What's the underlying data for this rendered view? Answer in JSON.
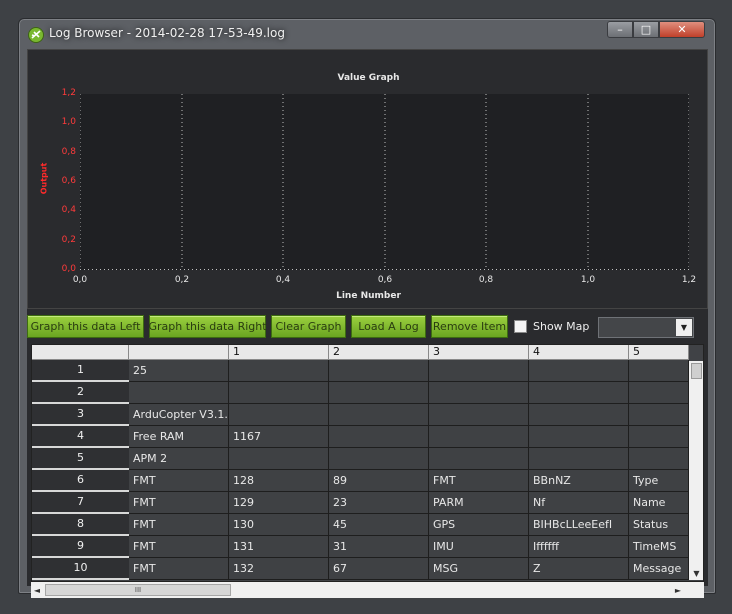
{
  "window": {
    "title": "Log Browser - 2014-02-28 17-53-49.log",
    "minimize_glyph": "–",
    "maximize_glyph": "□",
    "close_glyph": "✕"
  },
  "chart_data": {
    "type": "line",
    "title": "Value Graph",
    "xlabel": "Line Number",
    "ylabel": "Output",
    "x_ticks": [
      "0,0",
      "0,2",
      "0,4",
      "0,6",
      "0,8",
      "1,0",
      "1,2"
    ],
    "y_ticks": [
      "1,2",
      "1,0",
      "0,8",
      "0,6",
      "0,4",
      "0,2",
      "0,0"
    ],
    "xlim": [
      0,
      1.2
    ],
    "ylim": [
      0,
      1.2
    ],
    "series": [],
    "grid": true,
    "colors": {
      "background": "#1f2023",
      "ytick": "#ff3b3b",
      "ylabel": "#ff2a2a",
      "xtick": "#e8e8e8"
    }
  },
  "toolbar": {
    "graph_left": "Graph this data Left",
    "graph_right": "Graph this data Right",
    "clear_graph": "Clear Graph",
    "load_log": "Load A Log",
    "remove_item": "Remove Item",
    "show_map": "Show Map",
    "show_map_checked": false,
    "combo_value": ""
  },
  "grid": {
    "columns": [
      "",
      "1",
      "2",
      "3",
      "4",
      "5"
    ],
    "rows": [
      {
        "num": "1",
        "cells": [
          "25",
          "",
          "",
          "",
          "",
          ""
        ]
      },
      {
        "num": "2",
        "cells": [
          "",
          "",
          "",
          "",
          "",
          ""
        ]
      },
      {
        "num": "3",
        "cells": [
          "ArduCopter V3.1....",
          "",
          "",
          "",
          "",
          ""
        ]
      },
      {
        "num": "4",
        "cells": [
          "Free RAM",
          "1167",
          "",
          "",
          "",
          ""
        ]
      },
      {
        "num": "5",
        "cells": [
          "APM 2",
          "",
          "",
          "",
          "",
          ""
        ]
      },
      {
        "num": "6",
        "cells": [
          "FMT",
          "128",
          "89",
          "FMT",
          "BBnNZ",
          "Type"
        ]
      },
      {
        "num": "7",
        "cells": [
          "FMT",
          "129",
          "23",
          "PARM",
          "Nf",
          "Name"
        ]
      },
      {
        "num": "8",
        "cells": [
          "FMT",
          "130",
          "45",
          "GPS",
          "BIHBcLLeeEefI",
          "Status"
        ]
      },
      {
        "num": "9",
        "cells": [
          "FMT",
          "131",
          "31",
          "IMU",
          "Iffffff",
          "TimeMS"
        ]
      },
      {
        "num": "10",
        "cells": [
          "FMT",
          "132",
          "67",
          "MSG",
          "Z",
          "Message"
        ]
      }
    ]
  },
  "scrollbars": {
    "hthumb_grip": "III",
    "up": "▲",
    "down": "▼",
    "left": "◄",
    "right": "►"
  },
  "accent_colors": {
    "button_green": "#86c232",
    "close_red": "#c8452e"
  }
}
